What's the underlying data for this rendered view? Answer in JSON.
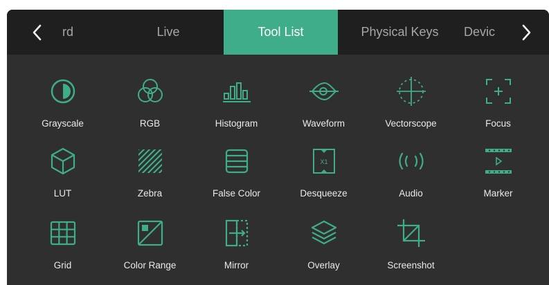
{
  "accent_color": "#3fad8a",
  "tabbar": {
    "prev_icon": "chevron-left-icon",
    "next_icon": "chevron-right-icon",
    "tabs": [
      {
        "label": "rd",
        "active": false
      },
      {
        "label": "Live",
        "active": false
      },
      {
        "label": "Tool List",
        "active": true
      },
      {
        "label": "Physical Keys",
        "active": false
      },
      {
        "label": "Devic",
        "active": false
      }
    ]
  },
  "tools": [
    {
      "label": "Grayscale",
      "icon": "grayscale-icon"
    },
    {
      "label": "RGB",
      "icon": "rgb-icon"
    },
    {
      "label": "Histogram",
      "icon": "histogram-icon"
    },
    {
      "label": "Waveform",
      "icon": "waveform-icon"
    },
    {
      "label": "Vectorscope",
      "icon": "vectorscope-icon"
    },
    {
      "label": "Focus",
      "icon": "focus-icon"
    },
    {
      "label": "LUT",
      "icon": "lut-icon"
    },
    {
      "label": "Zebra",
      "icon": "zebra-icon"
    },
    {
      "label": "False Color",
      "icon": "false-color-icon"
    },
    {
      "label": "Desqueeze",
      "icon": "desqueeze-icon"
    },
    {
      "label": "Audio",
      "icon": "audio-icon"
    },
    {
      "label": "Marker",
      "icon": "marker-icon"
    },
    {
      "label": "Grid",
      "icon": "grid-icon"
    },
    {
      "label": "Color Range",
      "icon": "color-range-icon"
    },
    {
      "label": "Mirror",
      "icon": "mirror-icon"
    },
    {
      "label": "Overlay",
      "icon": "overlay-icon"
    },
    {
      "label": "Screenshot",
      "icon": "screenshot-icon"
    }
  ]
}
